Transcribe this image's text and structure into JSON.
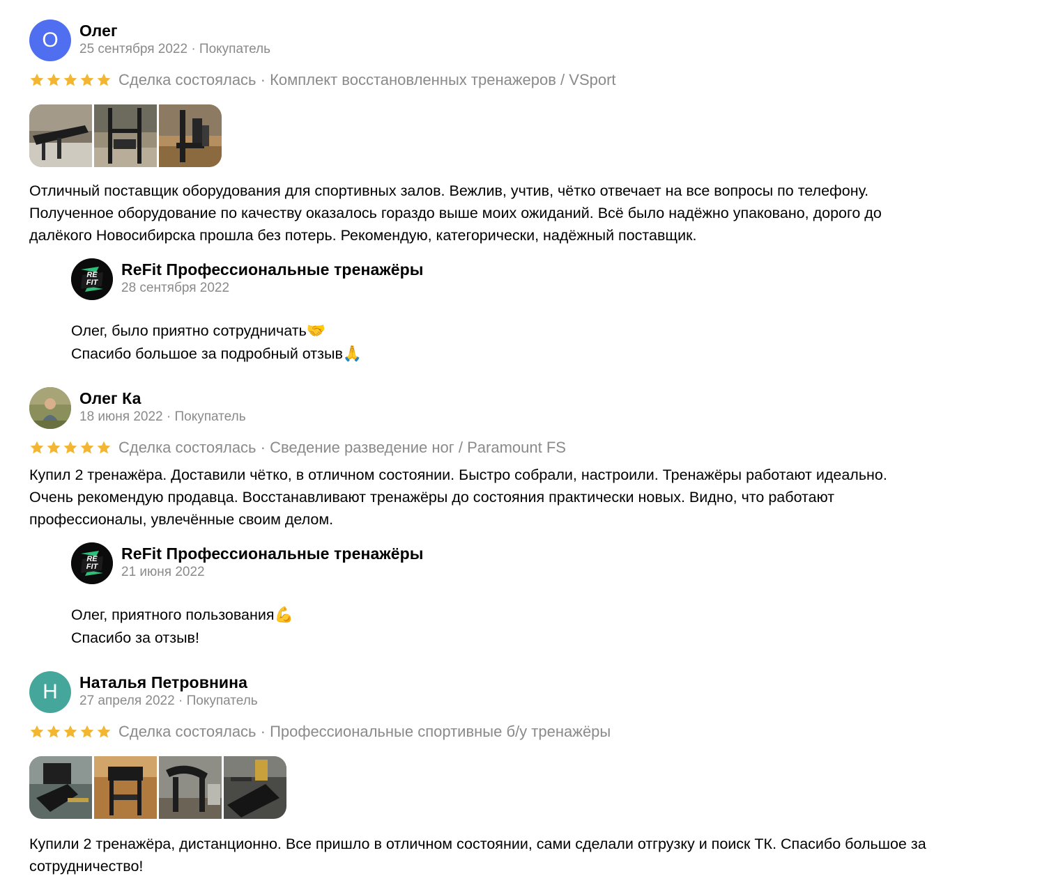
{
  "colors": {
    "star": "#f2b632",
    "muted_text": "#8a8a8a",
    "avatar_oleg": "#4f6ef0",
    "avatar_natalya": "#45a79b",
    "refit_badge": "#0b0b0b",
    "refit_arrow": "#2fbf7a"
  },
  "reviews": [
    {
      "author": "Олег",
      "initial": "О",
      "date": "25 сентября 2022",
      "role": "· Покупатель",
      "rating": 5,
      "deal": "Сделка состоялась · Комплект восстановленных тренажеров / VSport",
      "text": "Отличный поставщик оборудования для спортивных залов. Вежлив, учтив, чётко отвечает на все вопросы по телефону.\nПолученное оборудование по качеству оказалось гораздо выше моих ожиданий. Всё было надёжно упаковано, дорого до\nдалёкого Новосибирска прошла без потерь. Рекомендую, категорически, надёжный поставщик.",
      "photos_count": 3,
      "reply": {
        "author": "ReFit Профессиональные тренажёры",
        "logo_text": "RE FIT",
        "date": "28 сентября 2022",
        "line1": "Олег, было приятно сотрудничать",
        "emoji1": "🤝",
        "line2": "Спасибо большое за подробный отзыв",
        "emoji2": "🙏"
      }
    },
    {
      "author": "Олег Ка",
      "date": "18 июня 2022",
      "role": "· Покупатель",
      "rating": 5,
      "deal": "Сделка состоялась · Сведение разведение ног / Paramount FS",
      "text": "Купил 2 тренажёра. Доставили чётко, в отличном состоянии. Быстро собрали, настроили. Тренажёры работают идеально.\nОчень рекомендую продавца. Восстанавливают тренажёры до состояния практически новых. Видно, что работают\nпрофессионалы, увлечённые своим делом.",
      "reply": {
        "author": "ReFit Профессиональные тренажёры",
        "logo_text": "RE FIT",
        "date": "21 июня 2022",
        "line1": "Олег, приятного пользования",
        "emoji1": "💪",
        "line2": "Спасибо за отзыв!"
      }
    },
    {
      "author": "Наталья Петровнина",
      "initial": "Н",
      "date": "27 апреля 2022",
      "role": "· Покупатель",
      "rating": 5,
      "deal": "Сделка состоялась · Профессиональные спортивные б/у тренажёры",
      "text": "Купили 2 тренажёра, дистанционно. Все пришло в отличном состоянии, сами сделали отгрузку и поиск ТК. Спасибо большое за\nсотрудничество!",
      "photos_count": 4
    }
  ]
}
